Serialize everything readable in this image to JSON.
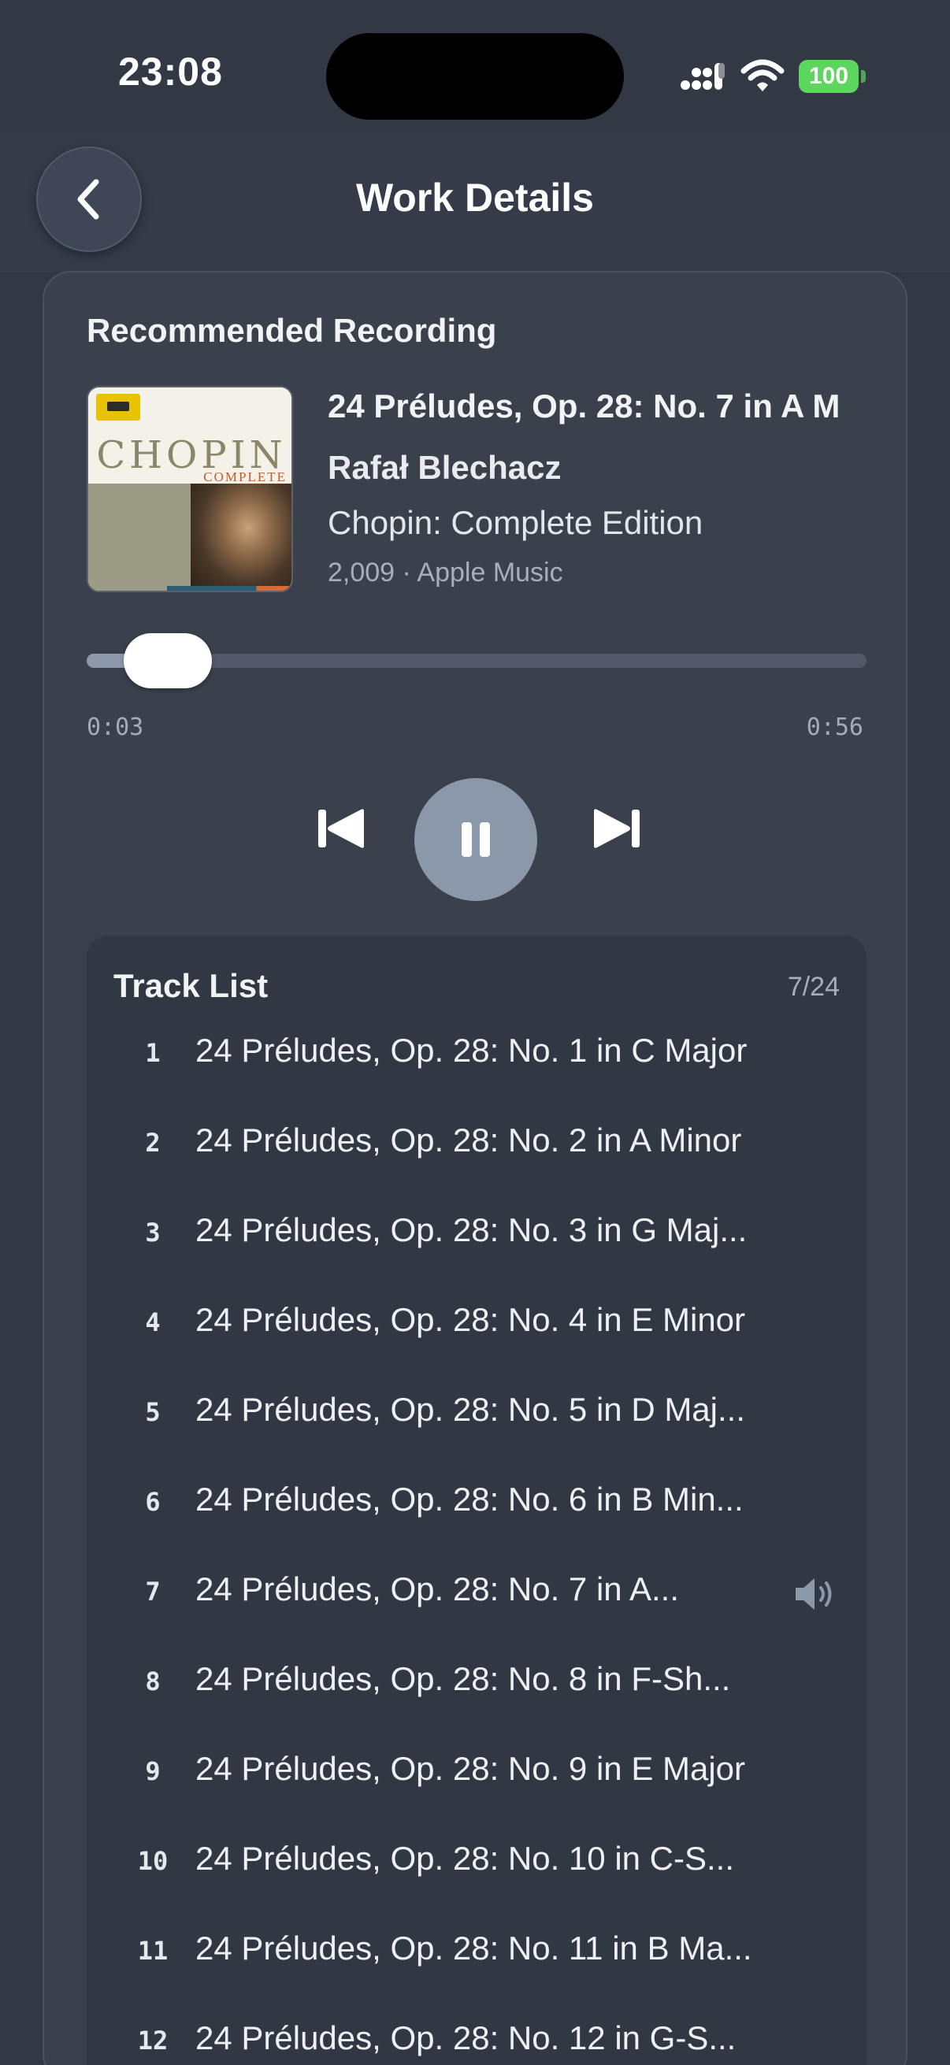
{
  "status": {
    "time": "23:08",
    "battery": "100"
  },
  "nav": {
    "title": "Work Details"
  },
  "recording": {
    "section_title": "Recommended Recording",
    "album_art_text": "CHOPIN",
    "album_art_subtext": "COMPLETE EDITION",
    "track_title": "24 Préludes, Op. 28: No. 7 in A M",
    "artist": "Rafał Blechacz",
    "album": "Chopin: Complete Edition",
    "meta": "2,009 · Apple Music"
  },
  "player": {
    "elapsed": "0:03",
    "duration": "0:56",
    "progress_fraction": 0.054,
    "state": "playing"
  },
  "tracklist": {
    "title": "Track List",
    "count": "7/24",
    "now_playing_index": 7,
    "tracks": [
      {
        "num": "1",
        "title": "24 Préludes, Op. 28: No. 1 in C Major"
      },
      {
        "num": "2",
        "title": "24 Préludes, Op. 28: No. 2 in A Minor"
      },
      {
        "num": "3",
        "title": "24 Préludes, Op. 28: No. 3 in G Maj..."
      },
      {
        "num": "4",
        "title": "24 Préludes, Op. 28: No. 4 in E Minor"
      },
      {
        "num": "5",
        "title": "24 Préludes, Op. 28: No. 5 in D Maj..."
      },
      {
        "num": "6",
        "title": "24 Préludes, Op. 28: No. 6 in B Min..."
      },
      {
        "num": "7",
        "title": "24 Préludes, Op. 28: No. 7 in A..."
      },
      {
        "num": "8",
        "title": "24 Préludes, Op. 28: No. 8 in F-Sh..."
      },
      {
        "num": "9",
        "title": "24 Préludes, Op. 28: No. 9 in E Major"
      },
      {
        "num": "10",
        "title": "24 Préludes, Op. 28: No. 10 in C-S..."
      },
      {
        "num": "11",
        "title": "24 Préludes, Op. 28: No. 11 in B Ma..."
      },
      {
        "num": "12",
        "title": "24 Préludes, Op. 28: No. 12 in G-S..."
      }
    ]
  },
  "colors": {
    "background": "#323844",
    "card": "#3a404c",
    "accent": "#8b98aa",
    "battery": "#5cd65c"
  }
}
